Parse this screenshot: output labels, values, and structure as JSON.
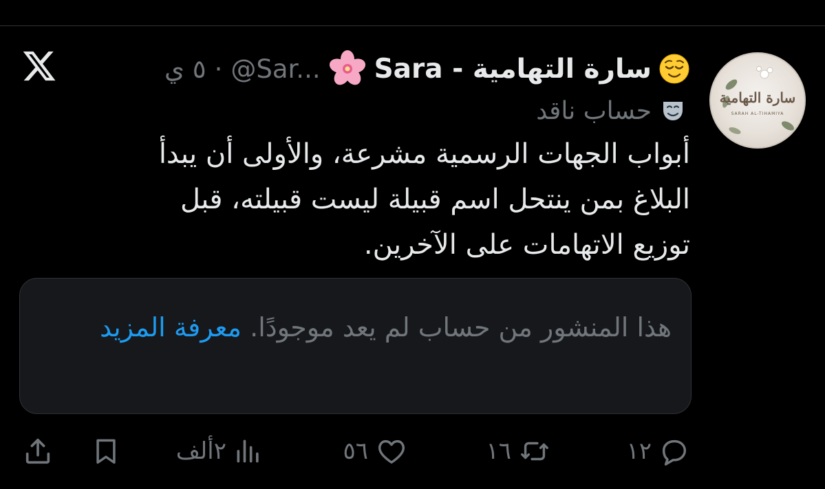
{
  "post": {
    "display_name": "سارة التهامية - Sara",
    "handle": "@Sar...",
    "time": "٥ ي",
    "separator": "·",
    "account_label": "حساب ناقد",
    "text": "أبواب الجهات الرسمية مشرعة، والأولى أن يبدأ البلاغ بمن ينتحل اسم قبيلة ليست قبيلته، قبل توزيع الاتهامات على الآخرين.",
    "notice_text": "هذا المنشور من حساب لم يعد موجودًا.",
    "notice_link": "معرفة المزيد"
  },
  "actions": {
    "replies": "١٢",
    "reposts": "١٦",
    "likes": "٥٦",
    "views": "٢ألف"
  },
  "avatar": {
    "title": "سارة التهامية",
    "subtitle": "SARAH AL-TIHAMIYA"
  },
  "icons": {
    "close": "x-logo-icon",
    "face": "relieved-face-emoji-icon",
    "flower": "cherry-blossom-emoji-icon",
    "mask": "performing-arts-mask-icon",
    "reply": "reply-icon",
    "repost": "repost-icon",
    "like": "heart-icon",
    "views": "views-chart-icon",
    "bookmark": "bookmark-icon",
    "share": "share-icon"
  },
  "colors": {
    "background": "#000000",
    "text": "#e7e9ea",
    "muted": "#71767b",
    "link": "#1d9bf0",
    "notice_bg": "#16181c",
    "border": "#2f3336"
  }
}
